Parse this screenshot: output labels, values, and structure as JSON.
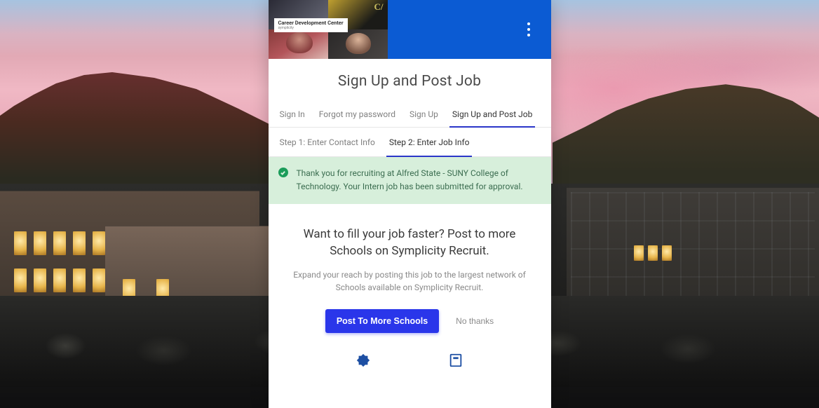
{
  "colors": {
    "primary": "#0b5bd3",
    "accent": "#2a36ea",
    "success": "#1b9c5a"
  },
  "header": {
    "brand_label": "Career Development Center",
    "brand_subtext": "symplicity"
  },
  "page": {
    "title": "Sign Up and Post Job"
  },
  "tabs": {
    "items": [
      {
        "label": "Sign In",
        "active": false
      },
      {
        "label": "Forgot my password",
        "active": false
      },
      {
        "label": "Sign Up",
        "active": false
      },
      {
        "label": "Sign Up and Post Job",
        "active": true
      }
    ]
  },
  "steps": {
    "items": [
      {
        "label": "Step 1: Enter Contact Info",
        "active": false
      },
      {
        "label": "Step 2: Enter Job Info",
        "active": true
      }
    ]
  },
  "alert": {
    "message": "Thank you for recruiting at Alfred State - SUNY College of Technology. Your Intern job has been submitted for approval."
  },
  "promo": {
    "heading": "Want to fill your job faster? Post to more Schools on Symplicity Recruit.",
    "subtext": "Expand your reach by posting this job to the largest network of Schools available on Symplicity Recruit.",
    "primary_label": "Post To More Schools",
    "secondary_label": "No thanks"
  }
}
